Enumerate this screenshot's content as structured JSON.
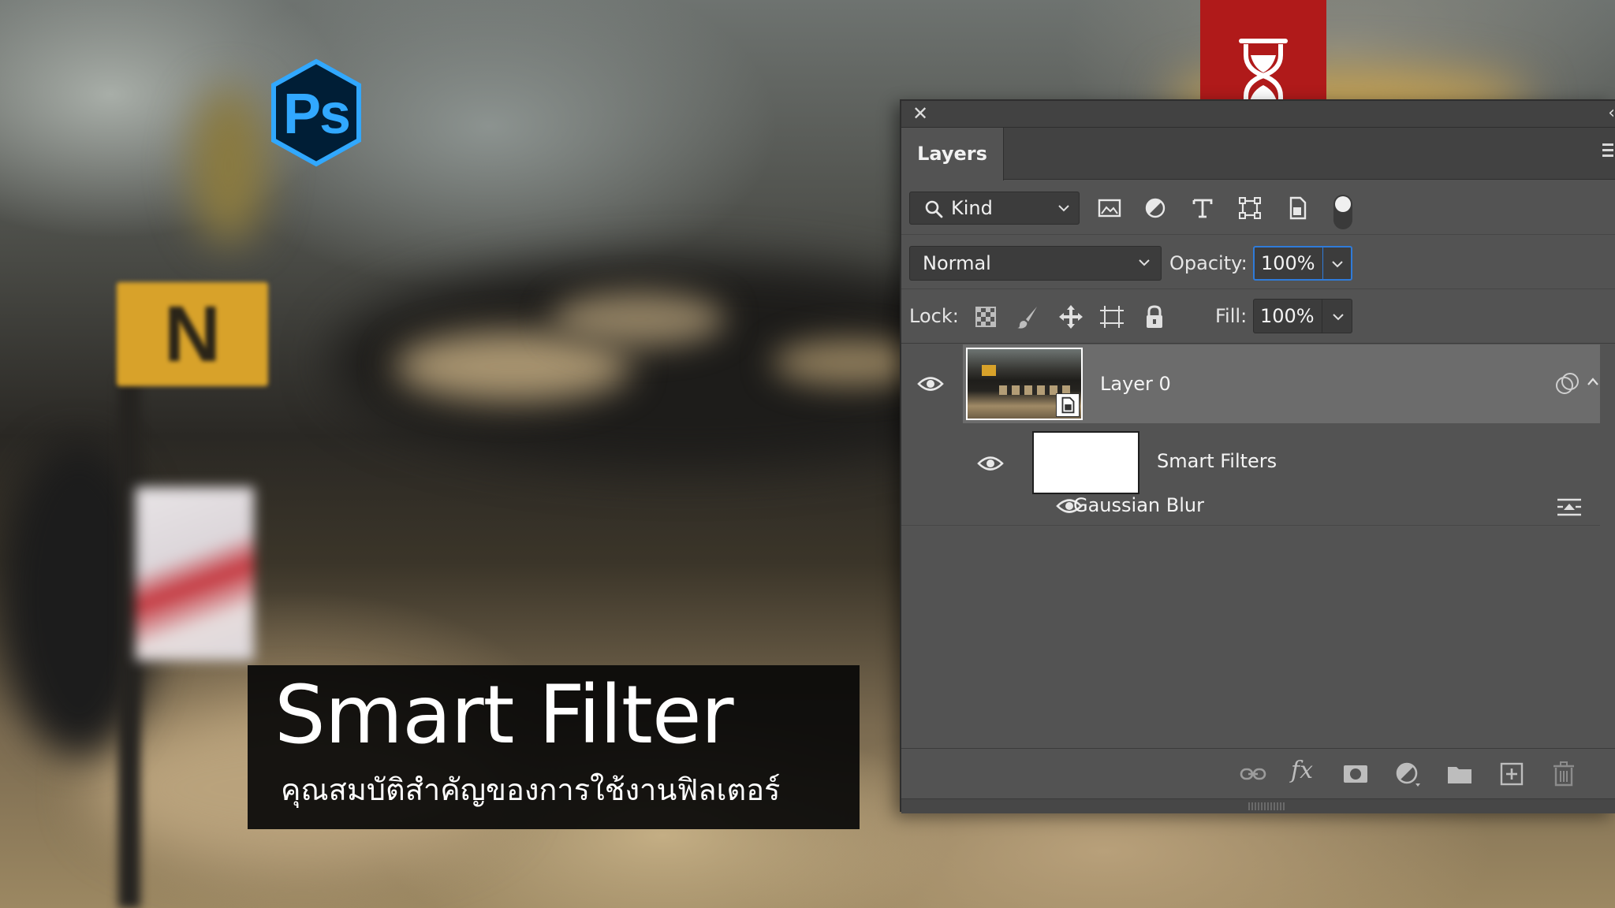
{
  "overlay": {
    "logo_text": "Ps",
    "sign_text": "N",
    "title": "Smart Filter",
    "subtitle": "คุณสมบัติสำคัญของการใช้งานฟิลเตอร์"
  },
  "colors": {
    "ps_blue": "#31a8ff",
    "ps_dark": "#001e36",
    "banner_red": "#b01a1a",
    "panel_bg": "#535353",
    "selected_row": "#6c6c6c",
    "focus_blue": "#2f7bd9"
  },
  "panel": {
    "tab_label": "Layers",
    "filter": {
      "kind_label": "Kind",
      "icons": [
        "image-filter-icon",
        "adjustment-filter-icon",
        "type-filter-icon",
        "shape-filter-icon",
        "smart-object-filter-icon"
      ]
    },
    "blend_mode": "Normal",
    "opacity_label": "Opacity:",
    "opacity_value": "100%",
    "lock_label": "Lock:",
    "fill_label": "Fill:",
    "fill_value": "100%",
    "layers": {
      "layer0_name": "Layer 0",
      "smart_filters_label": "Smart Filters",
      "gaussian_blur_label": "Gaussian Blur"
    },
    "footer_icons": [
      "link-layers-icon",
      "fx-icon",
      "layer-mask-icon",
      "new-adjustment-icon",
      "new-group-icon",
      "new-layer-icon",
      "delete-layer-icon"
    ],
    "fx_label": "fx"
  }
}
